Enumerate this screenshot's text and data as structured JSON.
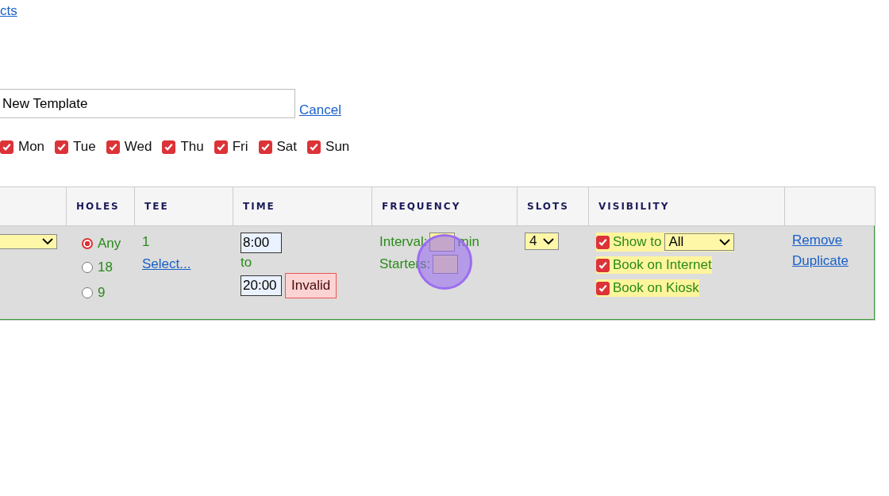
{
  "header_link": {
    "text": "cts"
  },
  "template_name": {
    "value": "New Template"
  },
  "cancel_link": {
    "text": "Cancel"
  },
  "days": [
    {
      "label": "Mon",
      "checked": true
    },
    {
      "label": "Tue",
      "checked": true
    },
    {
      "label": "Wed",
      "checked": true
    },
    {
      "label": "Thu",
      "checked": true
    },
    {
      "label": "Fri",
      "checked": true
    },
    {
      "label": "Sat",
      "checked": true
    },
    {
      "label": "Sun",
      "checked": true
    }
  ],
  "table": {
    "columns": [
      "HOLES",
      "TEE",
      "TIME",
      "FREQUENCY",
      "SLOTS",
      "VISIBILITY"
    ],
    "row": {
      "holes": [
        {
          "label": "Any",
          "selected": true
        },
        {
          "label": "18",
          "selected": false
        },
        {
          "label": "9",
          "selected": false
        }
      ],
      "tee": {
        "value": "1",
        "link": "Select..."
      },
      "time": {
        "start": "8:00",
        "separator": "to",
        "end": "20:00",
        "error": "Invalid"
      },
      "frequency": {
        "interval_label": "Interval:",
        "unit": "min",
        "starters_label": "Starters:"
      },
      "slots": {
        "value": "4"
      },
      "visibility": [
        {
          "kind": "select",
          "label": "Show to",
          "checked": true,
          "value": "All"
        },
        {
          "kind": "plain",
          "label": "Book on Internet",
          "checked": true
        },
        {
          "kind": "plain",
          "label": "Book on Kiosk",
          "checked": true
        }
      ],
      "actions": [
        "Remove",
        "Duplicate"
      ]
    }
  }
}
